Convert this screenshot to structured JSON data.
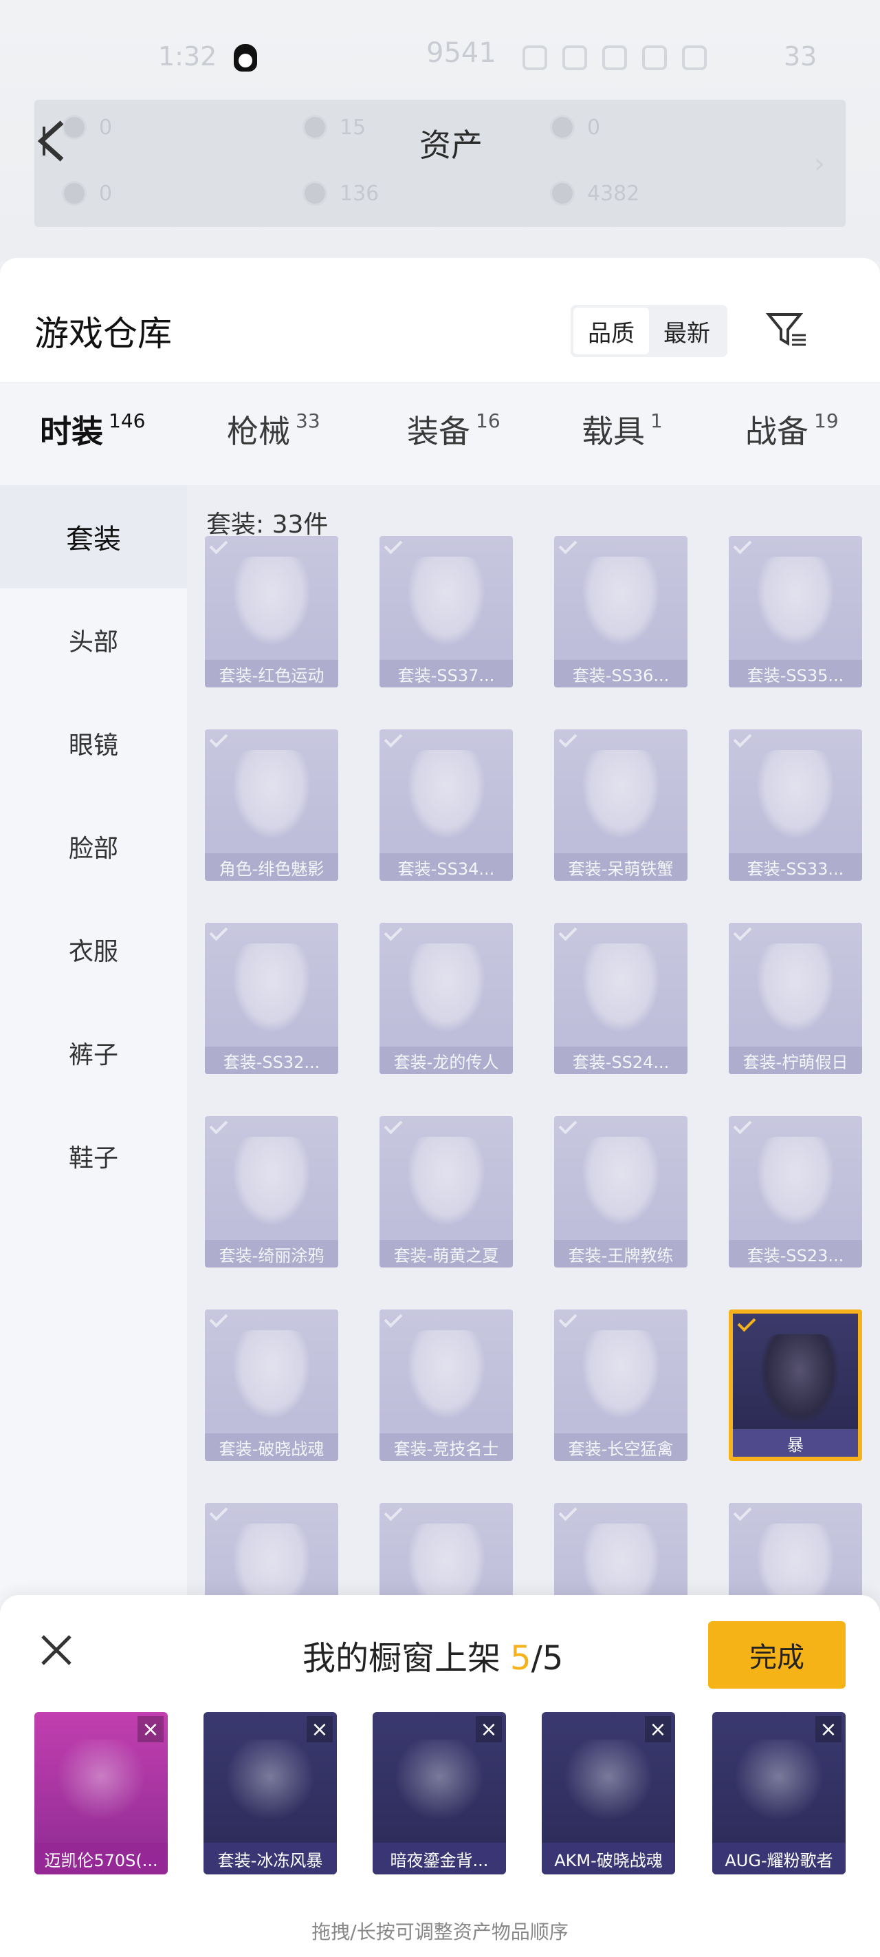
{
  "status_bar": {
    "time": "1:32",
    "steps": "9541",
    "battery": "33"
  },
  "assets": {
    "title": "资产",
    "cells": [
      "0",
      "15",
      "0",
      "0",
      "136",
      "4382"
    ]
  },
  "warehouse": {
    "title": "游戏仓库",
    "sort_options": [
      "品质",
      "最新"
    ],
    "tabs": [
      {
        "label": "时装",
        "count": "146"
      },
      {
        "label": "枪械",
        "count": "33"
      },
      {
        "label": "装备",
        "count": "16"
      },
      {
        "label": "载具",
        "count": "1"
      },
      {
        "label": "战备",
        "count": "19"
      }
    ],
    "categories": [
      "套装",
      "头部",
      "眼镜",
      "脸部",
      "衣服",
      "裤子",
      "鞋子"
    ],
    "caption": "套装: 33件",
    "items": [
      "套装-红色运动",
      "套装-SS37...",
      "套装-SS36...",
      "套装-SS35...",
      "角色-绯色魅影",
      "套装-SS34...",
      "套装-呆萌铁蟹",
      "套装-SS33...",
      "套装-SS32...",
      "套装-龙的传人",
      "套装-SS24...",
      "套装-柠萌假日",
      "套装-绮丽涂鸦",
      "套装-萌黄之夏",
      "套装-王牌教练",
      "套装-SS23...",
      "套装-破晓战魂",
      "套装-竞技名士",
      "套装-长空猛禽",
      "暴",
      "",
      "",
      "",
      ""
    ]
  },
  "showcase": {
    "title_prefix": "我的橱窗上架",
    "current": "5",
    "total": "/5",
    "done_label": "完成",
    "remove_glyph": "×",
    "slots": [
      "迈凯伦570S(...",
      "套装-冰冻风暴",
      "暗夜鎏金背...",
      "AKM-破晓战魂",
      "AUG-耀粉歌者"
    ],
    "hint": "拖拽/长按可调整资产物品顺序"
  }
}
